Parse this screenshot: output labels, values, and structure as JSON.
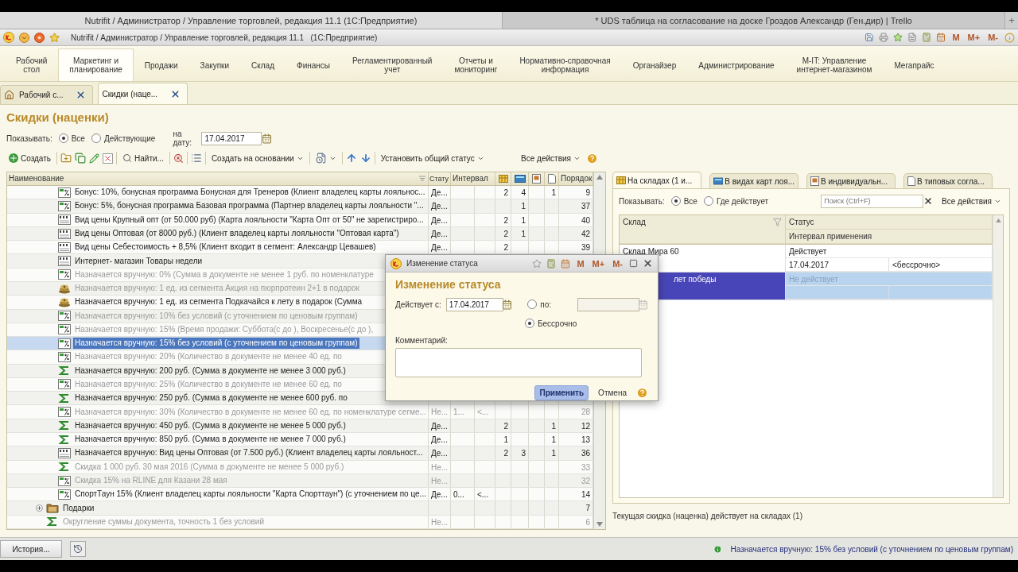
{
  "browser_tabs": [
    {
      "title": "Nutrifit / Администратор / Управление торговлей, редакция 11.1 (1С:Предприятие)",
      "selected": true
    },
    {
      "title": "* UDS таблица на согласование на доске Гроздов Александр (Ген.дир) | Trello",
      "selected": false
    }
  ],
  "new_tab": "+",
  "window": {
    "title": "Nutrifit / Администратор / Управление торговлей, редакция 11.1   (1С:Предприятие)",
    "memory_buttons": [
      "M",
      "M+",
      "M-"
    ]
  },
  "sections": [
    {
      "label": "Рабочий\nстол",
      "selected": false
    },
    {
      "label": "Маркетинг и\nпланирование",
      "selected": true
    },
    {
      "label": "Продажи",
      "selected": false
    },
    {
      "label": "Закупки",
      "selected": false
    },
    {
      "label": "Склад",
      "selected": false
    },
    {
      "label": "Финансы",
      "selected": false
    },
    {
      "label": "Регламентированный\nучет",
      "selected": false
    },
    {
      "label": "Отчеты и\nмониторинг",
      "selected": false
    },
    {
      "label": "Нормативно-справочная\nинформация",
      "selected": false
    },
    {
      "label": "Органайзер",
      "selected": false
    },
    {
      "label": "Администрирование",
      "selected": false
    },
    {
      "label": "M-IT: Управление\nинтернет-магазином",
      "selected": false
    },
    {
      "label": "Мегапрайс",
      "selected": false
    }
  ],
  "open_tabs": [
    {
      "label": "Рабочий с...",
      "kind": "home",
      "selected": false
    },
    {
      "label": "Скидки (наце...",
      "kind": "form",
      "selected": true
    }
  ],
  "form": {
    "title": "Скидки (наценки)",
    "filter": {
      "label": "Показывать:",
      "options": [
        {
          "label": "Все",
          "selected": true
        },
        {
          "label": "Действующие",
          "selected": false
        }
      ],
      "date_label": "на дату:",
      "date": "17.04.2017"
    },
    "toolbar": {
      "create": "Создать",
      "find": "Найти...",
      "create_based": "Создать на основании",
      "set_status": "Установить общий статус",
      "all_actions": "Все действия"
    },
    "table": {
      "columns": {
        "name": "Наименование",
        "status": "Стату",
        "interval": "Интервал",
        "order": "Порядок"
      },
      "rows": [
        {
          "children": [
            {
              "name": "Бонус: 10%, бонусная программа Бонусная для Тренеров (Клиент владелец карты лояльнос...",
              "kind": "percent",
              "disabled": false,
              "selected": false,
              "cells": {
                "status": "Де...",
                "c1": "2",
                "c2": "4",
                "c4": "1",
                "order": "9"
              }
            },
            {
              "name": "Бонус: 5%, бонусная программа Базовая программа  (Партнер владелец карты лояльности \"...",
              "kind": "percent",
              "disabled": false,
              "selected": false,
              "cells": {
                "status": "Де...",
                "c2": "1",
                "order": "37"
              }
            },
            {
              "name": "Вид цены Крупный опт (от 50.000 руб) (Карта лояльности \"Карта Опт от 50\" не зарегистриро...",
              "kind": "price",
              "disabled": false,
              "selected": false,
              "cells": {
                "status": "Де...",
                "c1": "2",
                "c2": "1",
                "order": "40"
              }
            },
            {
              "name": "Вид цены Оптовая (от 8000 руб.) (Клиент владелец карты лояльности \"Оптовая карта\")",
              "kind": "price",
              "disabled": false,
              "selected": false,
              "cells": {
                "status": "Де...",
                "c1": "2",
                "c2": "1",
                "order": "42"
              }
            },
            {
              "name": "Вид цены Себестоимость + 8,5% (Клиент входит в сегмент: Александр Цевашев)",
              "kind": "price",
              "disabled": false,
              "selected": false,
              "cells": {
                "status": "Де...",
                "c1": "2",
                "order": "39"
              }
            },
            {
              "name": "Интернет- магазин Товары недели",
              "kind": "price",
              "disabled": false,
              "selected": false
            },
            {
              "name": "Назначается вручную: 0% (Сумма в документе не менее 1 руб. по номенклатуре",
              "kind": "percent",
              "disabled": true,
              "selected": false
            },
            {
              "name": "Назначается вручную: 1 ед. из сегмента Акция на пюрпротеин 2+1 в подарок",
              "kind": "gift",
              "disabled": true,
              "selected": false
            },
            {
              "name": "Назначается вручную: 1 ед. из сегмента Подкачайся к лету в подарок (Сумма",
              "kind": "gift",
              "disabled": false,
              "selected": false
            },
            {
              "name": "Назначается вручную: 10% без условий (с уточнением по ценовым группам)",
              "kind": "percent",
              "disabled": true,
              "selected": false
            },
            {
              "name": "Назначается вручную: 15% (Время продажи: Суббота(с  до ), Воскресенье(с  до ),",
              "kind": "percent",
              "disabled": true,
              "selected": false
            },
            {
              "name": "Назначается вручную: 15% без условий (с уточнением по ценовым группам)",
              "kind": "percent",
              "disabled": false,
              "selected": true
            },
            {
              "name": "Назначается вручную: 20% (Количество в документе не менее 40 ед. по",
              "kind": "percent",
              "disabled": true,
              "selected": false
            },
            {
              "name": "Назначается вручную: 200 руб. (Сумма в документе не менее 3 000 руб.)",
              "kind": "sum",
              "disabled": false,
              "selected": false
            },
            {
              "name": "Назначается вручную: 25% (Количество в документе не менее 60 ед. по",
              "kind": "percent",
              "disabled": true,
              "selected": false
            },
            {
              "name": "Назначается вручную: 250 руб. (Сумма в документе не менее 600 руб. по",
              "kind": "sum",
              "disabled": false,
              "selected": false
            },
            {
              "name": "Назначается вручную: 30% (Количество в документе не менее 60 ед. по номенклатуре сегме...",
              "kind": "percent",
              "disabled": true,
              "selected": false,
              "cells": {
                "status": "Не...",
                "from": "1...",
                "to": "<...",
                "order": "28"
              }
            },
            {
              "name": "Назначается вручную: 450 руб. (Сумма в документе не менее 5 000 руб.)",
              "kind": "sum",
              "disabled": false,
              "selected": false,
              "cells": {
                "status": "Де...",
                "c1": "2",
                "c4": "1",
                "order": "12"
              }
            },
            {
              "name": "Назначается вручную: 850 руб. (Сумма в документе не менее 7 000 руб.)",
              "kind": "sum",
              "disabled": false,
              "selected": false,
              "cells": {
                "status": "Де...",
                "c1": "1",
                "c4": "1",
                "order": "13"
              }
            },
            {
              "name": "Назначается вручную: Вид цены Оптовая (от 7.500 руб.) (Клиент владелец карты лояльност...",
              "kind": "price",
              "disabled": false,
              "selected": false,
              "cells": {
                "status": "Де...",
                "c1": "2",
                "c2": "3",
                "c4": "1",
                "order": "36"
              }
            },
            {
              "name": "Скидка 1 000 руб. 30 мая 2016 (Сумма в документе не менее 5 000 руб.)",
              "kind": "sum",
              "disabled": true,
              "selected": false,
              "cells": {
                "status": "Не...",
                "order": "33"
              }
            },
            {
              "name": "Скидка 15% на RLINE для Казани 28 мая",
              "kind": "percent",
              "disabled": true,
              "selected": false,
              "cells": {
                "status": "Не...",
                "order": "32"
              }
            },
            {
              "name": "СпортТаун 15% (Клиент владелец карты лояльности \"Карта Спорттаун\") (с уточнением по це...",
              "kind": "percent",
              "disabled": false,
              "selected": false,
              "cells": {
                "status": "Де...",
                "from": "0...",
                "to": "<...",
                "order": "14"
              }
            }
          ]
        },
        {
          "name": "Подарки",
          "kind": "group",
          "expanded": false,
          "disabled": false,
          "selected": false,
          "cells": {
            "order": "7"
          }
        },
        {
          "name": "Округление суммы документа, точность 1 без условий",
          "kind": "sum",
          "disabled": true,
          "selected": false,
          "cells": {
            "status": "Не...",
            "order": "6"
          }
        }
      ]
    }
  },
  "detail": {
    "tabs": [
      {
        "label": "На складах (1 и...",
        "kind": "grid",
        "selected": true
      },
      {
        "label": "В видах карт лоя...",
        "kind": "card",
        "selected": false
      },
      {
        "label": "В индивидуальн...",
        "kind": "photo",
        "selected": false
      },
      {
        "label": "В типовых согла...",
        "kind": "doc",
        "selected": false
      }
    ],
    "filter": {
      "label": "Показывать:",
      "options": [
        {
          "label": "Все",
          "selected": true
        },
        {
          "label": "Где действует",
          "selected": false
        }
      ]
    },
    "search": {
      "placeholder": "Поиск (Ctrl+F)"
    },
    "all_actions": "Все действия",
    "table": {
      "columns": {
        "warehouse": "Склад",
        "status": "Статус",
        "interval": "Интервал применения"
      },
      "rows": [
        {
          "name": "Склад Мира 60",
          "status": "Действует",
          "from": "17.04.2017",
          "to": "<бессрочно>",
          "selected": false
        },
        {
          "name": "лет победы",
          "status": "Не действует",
          "selected": true
        }
      ]
    },
    "footer": "Текущая скидка (наценка) действует на складах (1)"
  },
  "dialog": {
    "title": "Изменение статуса",
    "memory_buttons": [
      "M",
      "M+",
      "M-"
    ],
    "heading": "Изменение статуса",
    "from_label": "Действует с:",
    "from": "17.04.2017",
    "options": [
      {
        "label": "по:",
        "selected": false
      },
      {
        "label": "Бессрочно",
        "selected": true
      }
    ],
    "comment_label": "Комментарий:",
    "buttons": [
      {
        "label": "Применить",
        "default": true
      },
      {
        "label": "Отмена",
        "default": false
      }
    ]
  },
  "status_bar": {
    "history": "История...",
    "message": "Назначается вручную: 15% без условий (с уточнением по ценовым группам)"
  }
}
